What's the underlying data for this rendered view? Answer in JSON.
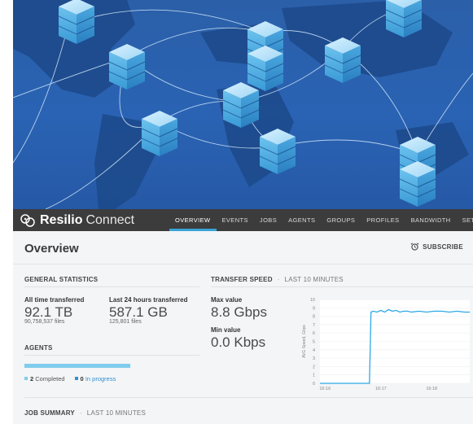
{
  "app": {
    "brand": "Resilio",
    "product": "Connect"
  },
  "nav": {
    "items": [
      {
        "label": "OVERVIEW",
        "active": true
      },
      {
        "label": "EVENTS"
      },
      {
        "label": "JOBS"
      },
      {
        "label": "AGENTS"
      },
      {
        "label": "GROUPS"
      },
      {
        "label": "PROFILES"
      },
      {
        "label": "BANDWIDTH"
      },
      {
        "label": "SETTINGS"
      }
    ]
  },
  "page": {
    "title": "Overview",
    "subscribe_label": "SUBSCRIBE"
  },
  "general_statistics": {
    "title": "GENERAL STATISTICS",
    "all_time_label": "All time transferred",
    "all_time_value": "92.1 TB",
    "all_time_files": "90,758,537 files",
    "last24_label": "Last 24 hours transferred",
    "last24_value": "587.1 GB",
    "last24_files": "125,801 files"
  },
  "agents": {
    "title": "AGENTS",
    "completed_count": "2",
    "completed_label": "Completed",
    "in_progress_count": "0",
    "in_progress_label": "In progress",
    "completed_fraction": 1.0
  },
  "transfer_speed": {
    "title": "TRANSFER SPEED",
    "period": "LAST 10 MINUTES",
    "max_label": "Max value",
    "max_value": "8.8 Gbps",
    "min_label": "Min value",
    "min_value": "0.0 Kbps"
  },
  "job_summary": {
    "title": "JOB SUMMARY",
    "period": "LAST 10 MINUTES"
  },
  "colors": {
    "accent": "#3aa3d8",
    "nav_bg": "#3c3c3c",
    "bar": "#7fcdee",
    "progress_text": "#2e8fd1"
  },
  "chart_data": {
    "type": "line",
    "ylabel": "AVG Speed, Gbps",
    "ylim": [
      0,
      10
    ],
    "yticks": [
      "0",
      "1",
      "2",
      "3",
      "4",
      "5",
      "6",
      "7",
      "8",
      "9",
      "10"
    ],
    "xticks": [
      {
        "label": "16:16",
        "x": 16.267
      },
      {
        "label": "16:17",
        "x": 17.0
      },
      {
        "label": "16:18",
        "x": 17.667
      }
    ],
    "xlim": [
      16.2,
      18.167
    ],
    "series": [
      {
        "x": [
          16.2,
          16.5,
          16.8,
          16.85,
          16.87,
          16.9,
          16.95,
          17.0,
          17.05,
          17.1,
          17.15,
          17.2,
          17.25,
          17.3,
          17.35,
          17.4,
          17.5,
          17.6,
          17.7,
          17.8,
          17.9,
          18.0,
          18.1,
          18.167
        ],
        "y": [
          0,
          0,
          0,
          0,
          8.5,
          8.6,
          8.5,
          8.7,
          8.5,
          8.8,
          8.6,
          8.7,
          8.5,
          8.6,
          8.6,
          8.5,
          8.6,
          8.5,
          8.6,
          8.6,
          8.5,
          8.6,
          8.5,
          8.5
        ]
      }
    ]
  }
}
